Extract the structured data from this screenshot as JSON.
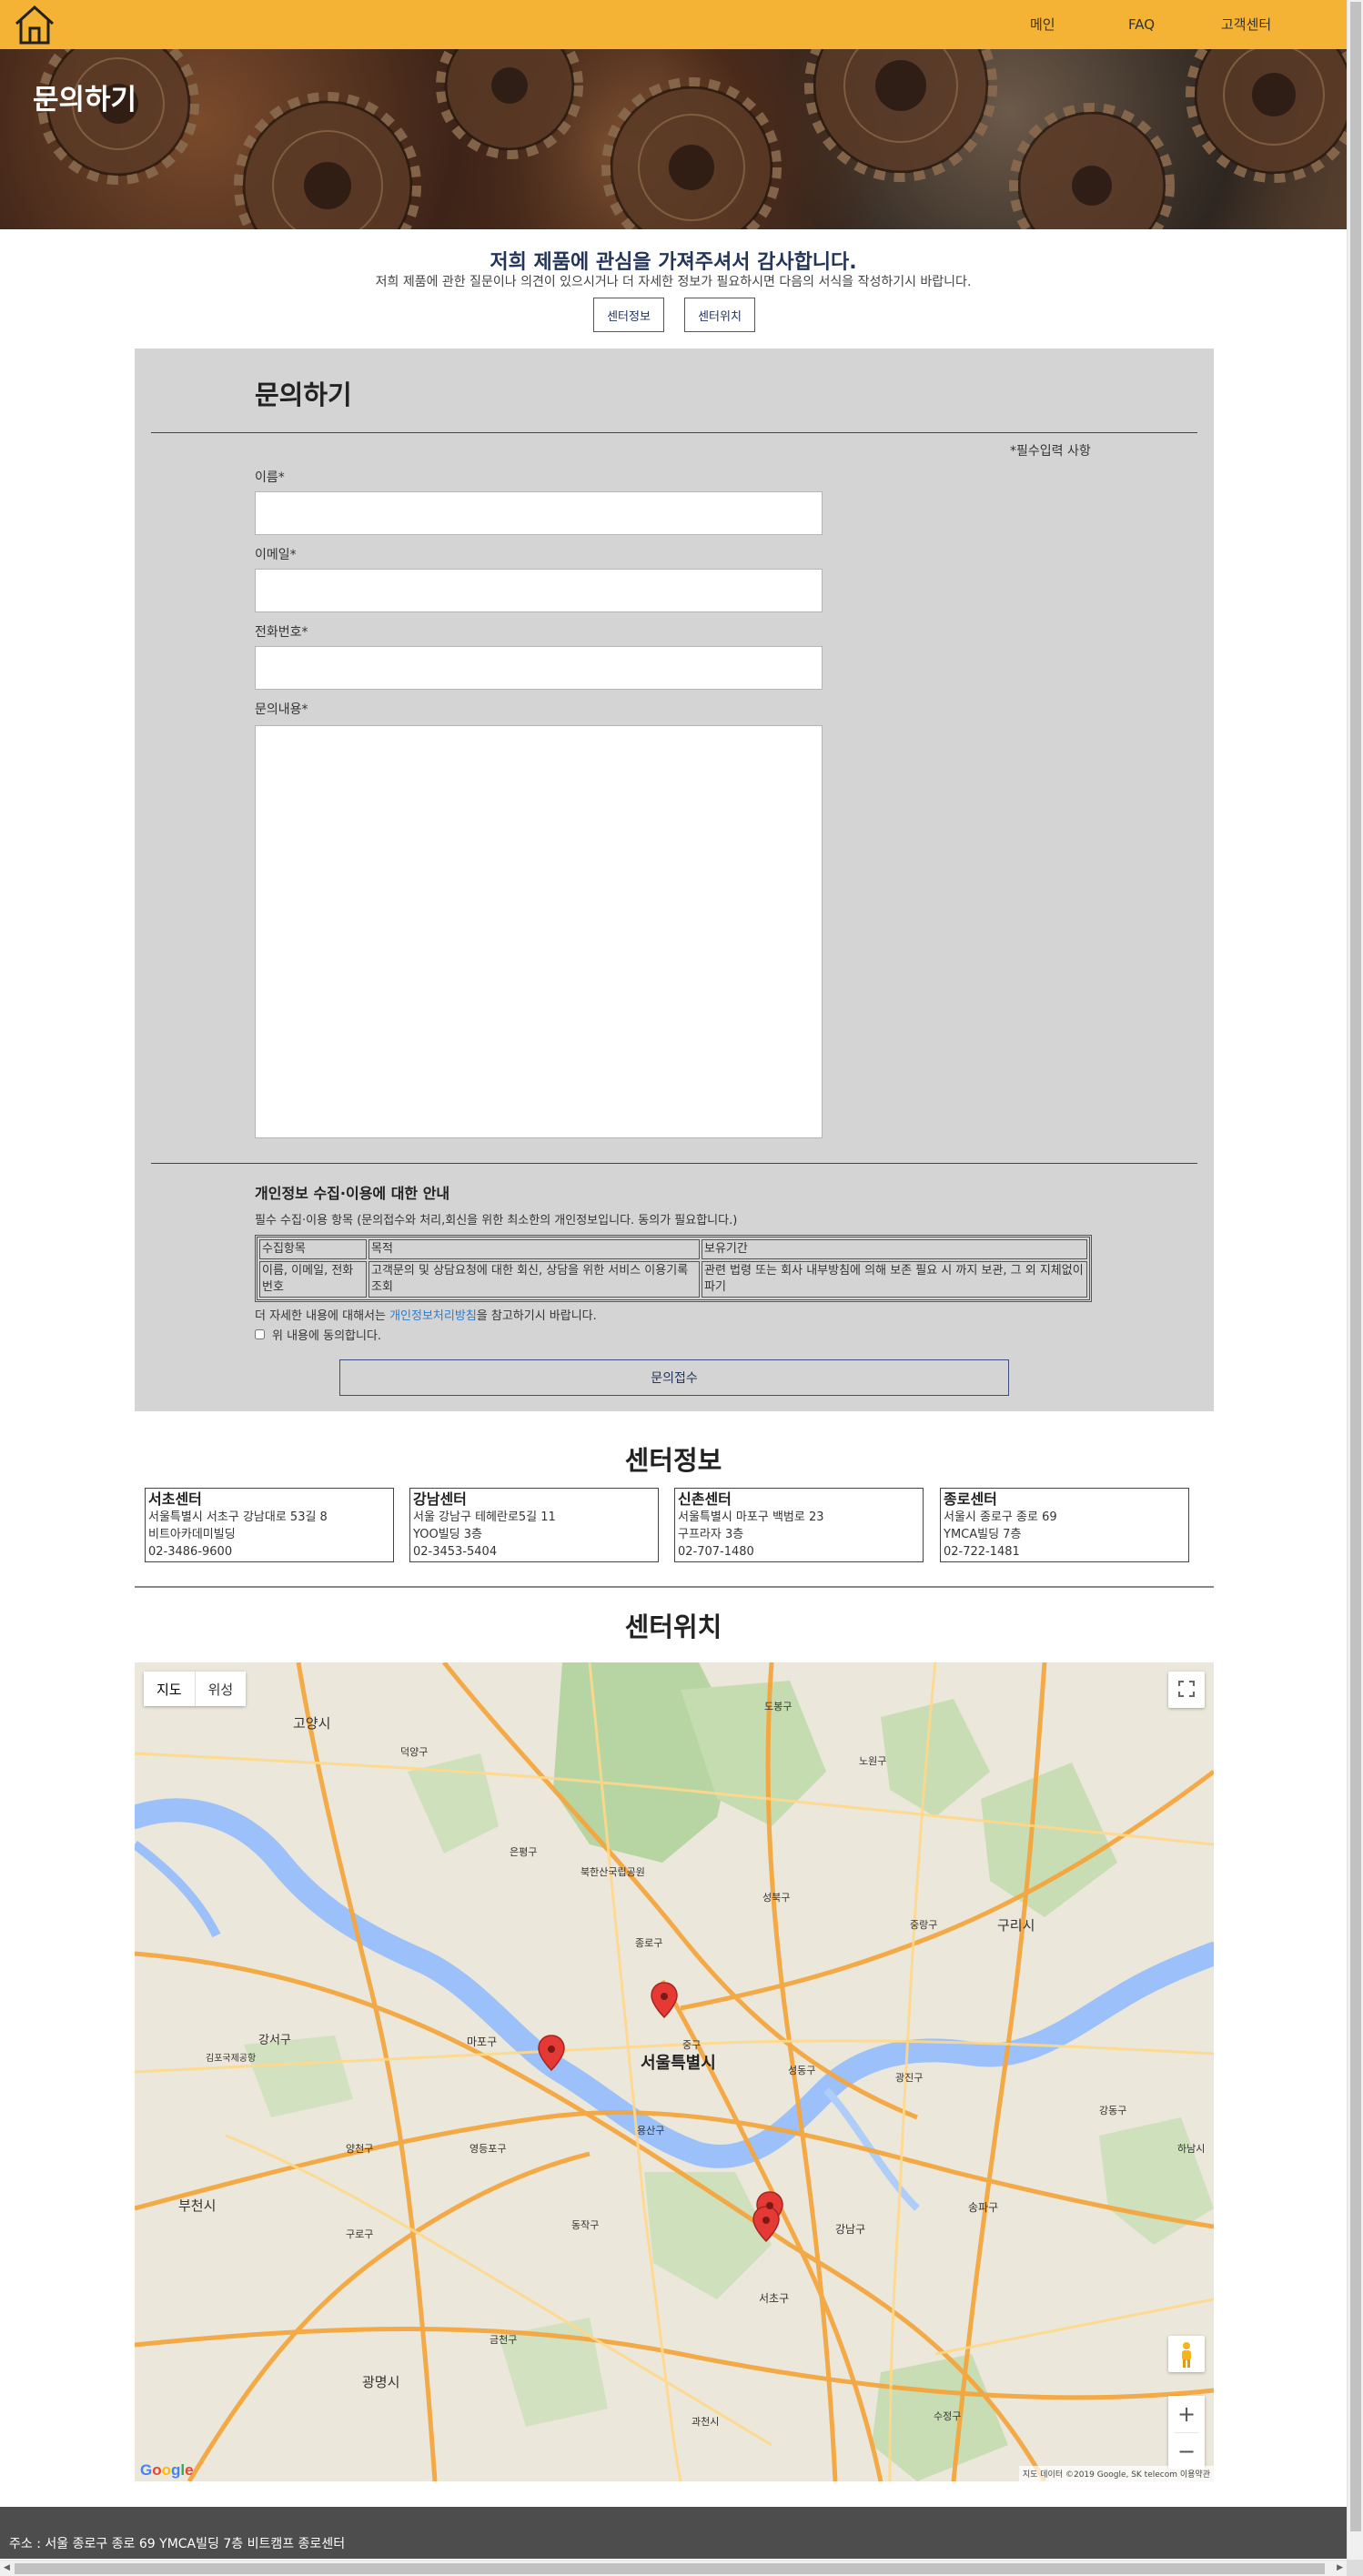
{
  "nav": {
    "home_icon": "home-icon",
    "items": [
      "메인",
      "FAQ",
      "고객센터"
    ]
  },
  "banner": {
    "title": "문의하기"
  },
  "intro": {
    "title": "저희 제품에 관심을 가져주셔서 감사합니다.",
    "subtitle": "저희 제품에 관한 질문이나 의견이 있으시거나 더 자세한 정보가 필요하시면 다음의 서식을 작성하기시 바랍니다.",
    "btn_center_info": "센터정보",
    "btn_center_location": "센터위치"
  },
  "form": {
    "title": "문의하기",
    "required_note": "*필수입력 사항",
    "name_label": "이름*",
    "email_label": "이메일*",
    "phone_label": "전화번호*",
    "message_label": "문의내용*",
    "name_value": "",
    "email_value": "",
    "phone_value": "",
    "message_value": ""
  },
  "privacy": {
    "title": "개인정보 수집·이용에 대한 안내",
    "desc": "필수 수집·이용 항목 (문의접수와 처리,회신을 위한 최소한의 개인정보입니다. 동의가 필요합니다.)",
    "table": {
      "headers": [
        "수집항목",
        "목적",
        "보유기간"
      ],
      "row": [
        "이름, 이메일, 전화번호",
        "고객문의 및 상담요청에 대한 회신, 상담을 위한 서비스 이용기록 조회",
        "관련 법령 또는 회사 내부방침에 의해 보존 필요 시 까지 보관, 그 외 지체없이 파기"
      ]
    },
    "more_prefix": "더 자세한 내용에 대해서는 ",
    "more_link": "개인정보처리방침",
    "more_suffix": "을 참고하기시 바랍니다.",
    "agree_label": "위 내용에 동의합니다.",
    "agree_checked": false,
    "submit": "문의접수"
  },
  "centers": {
    "title": "센터정보",
    "items": [
      {
        "name": "서초센터",
        "address": "서울특별시 서초구 강남대로 53길 8",
        "building": "비트아카데미빌딩",
        "phone": "02-3486-9600"
      },
      {
        "name": "강남센터",
        "address": "서울 강남구 테헤란로5길 11",
        "building": "YOO빌딩 3층",
        "phone": "02-3453-5404"
      },
      {
        "name": "신촌센터",
        "address": "서울특별시 마포구 백범로 23",
        "building": "구프라자 3층",
        "phone": "02-707-1480"
      },
      {
        "name": "종로센터",
        "address": "서울시 종로구 종로 69",
        "building": "YMCA빌딩 7층",
        "phone": "02-722-1481"
      }
    ]
  },
  "location": {
    "title": "센터위치",
    "map_type": [
      "지도",
      "위성"
    ],
    "zoom_in": "+",
    "zoom_out": "−",
    "google_logo": "Google",
    "attribution": "지도 데이터 ©2019 Google, SK telecom   이용약관",
    "labels": {
      "seoul": "서울특별시",
      "goyang": "고양시",
      "bucheon": "부천시",
      "gwangmyeong": "광명시",
      "gangseo": "강서구",
      "mapo": "마포구",
      "yongsan": "용산구",
      "jongno": "종로구",
      "gangnam": "강남구",
      "seocho": "서초구",
      "songpa": "송파구",
      "guri": "구리시",
      "hanam": "하남시",
      "gwacheon": "과천시",
      "dobong": "도봉구",
      "nowon": "노원구",
      "jungnang": "중랑구",
      "gwangjin": "광진구",
      "dongjak": "동작구",
      "yeongdeungpo": "영등포구",
      "guro": "구로구",
      "geumcheon": "금천구",
      "yangcheon": "양천구",
      "eunpyeong": "은평구",
      "seongbuk": "성북구",
      "seongdong": "성동구",
      "gangdong": "강동구",
      "sujeong": "수정구",
      "jung": "중구",
      "deogyang": "덕양구",
      "bukhansan": "북한산국립공원",
      "gimpo_airport": "김포국제공항"
    }
  },
  "footer": {
    "address": "주소 : 서울 종로구 종로 69 YMCA빌딩 7층 비트캠프 종로센터"
  },
  "colors": {
    "topbar": "#f5b335",
    "panel": "#d4d4d4",
    "footer": "#4d4d4d",
    "accent_text": "#24355a",
    "link": "#2a7fd4",
    "marker": "#e53935"
  }
}
